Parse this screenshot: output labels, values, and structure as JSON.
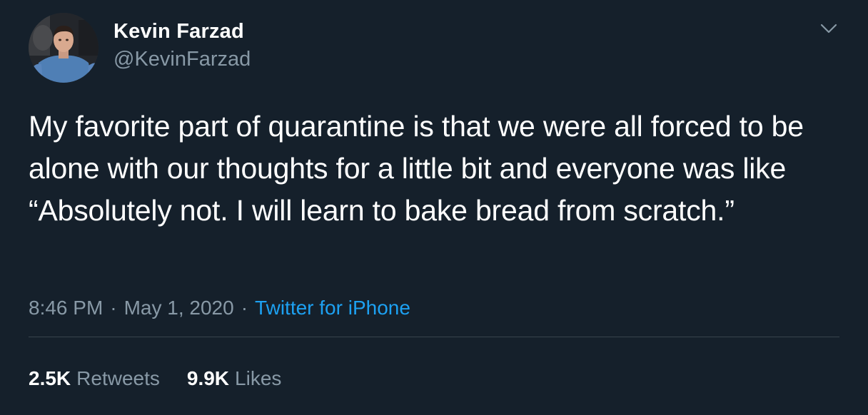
{
  "author": {
    "display_name": "Kevin Farzad",
    "handle": "@KevinFarzad"
  },
  "tweet": {
    "text": "My favorite part of quarantine is that we were all forced to be alone with our thoughts for a little bit and everyone was like “Absolutely not. I will learn to bake bread from scratch.”",
    "time": "8:46 PM",
    "date": "May 1, 2020",
    "separator": "·",
    "source": "Twitter for iPhone"
  },
  "stats": {
    "retweets_count": "2.5K",
    "retweets_label": "Retweets",
    "likes_count": "9.9K",
    "likes_label": "Likes"
  },
  "icons": {
    "menu": "chevron-down-icon"
  },
  "colors": {
    "background": "#15202b",
    "primary_text": "#ffffff",
    "secondary_text": "#8899a6",
    "link": "#1da1f2",
    "divider": "#38444d"
  }
}
